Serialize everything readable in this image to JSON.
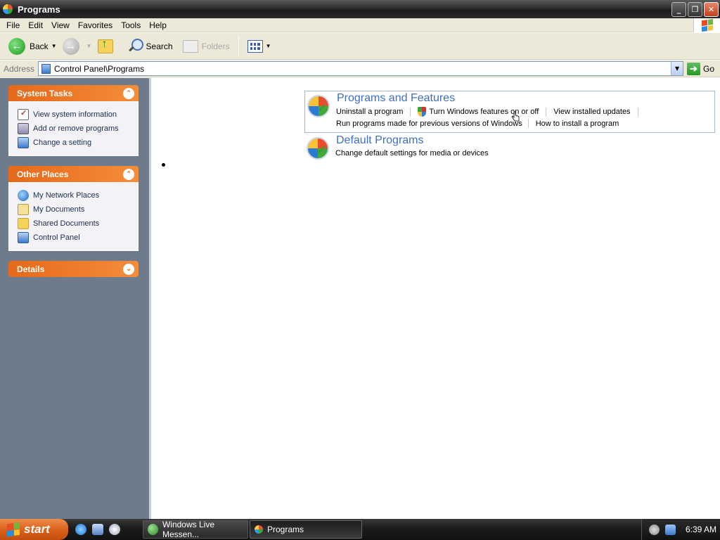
{
  "window": {
    "title": "Programs",
    "controls": [
      "minimize-icon",
      "restore-icon",
      "close-icon"
    ]
  },
  "menu": [
    "File",
    "Edit",
    "View",
    "Favorites",
    "Tools",
    "Help"
  ],
  "toolbar": {
    "back_label": "Back",
    "search_label": "Search",
    "folders_label": "Folders"
  },
  "address": {
    "label": "Address",
    "value": "Control Panel\\Programs",
    "go_label": "Go"
  },
  "sidebar": {
    "system_tasks": {
      "title": "System Tasks",
      "items": [
        {
          "label": "View system information",
          "icon": "system-info-icon"
        },
        {
          "label": "Add or remove programs",
          "icon": "add-remove-icon"
        },
        {
          "label": "Change a setting",
          "icon": "settings-icon"
        }
      ]
    },
    "other_places": {
      "title": "Other Places",
      "items": [
        {
          "label": "My Network Places",
          "icon": "network-icon"
        },
        {
          "label": "My Documents",
          "icon": "documents-icon"
        },
        {
          "label": "Shared Documents",
          "icon": "shared-folder-icon"
        },
        {
          "label": "Control Panel",
          "icon": "control-panel-icon"
        }
      ]
    },
    "details": {
      "title": "Details"
    }
  },
  "main": {
    "categories": [
      {
        "title": "Programs and Features",
        "links_row1": [
          "Uninstall a program",
          "Turn Windows features on or off",
          "View installed updates"
        ],
        "links_row2": [
          "Run programs made for previous versions of Windows",
          "How to install a program"
        ]
      },
      {
        "title": "Default Programs",
        "links_row1": [
          "Change default settings for media or devices"
        ]
      }
    ]
  },
  "taskbar": {
    "start_label": "start",
    "tasks": [
      "Windows Live Messen...",
      "Programs"
    ],
    "clock": "6:39 AM"
  },
  "colors": {
    "link_blue": "#3f6fc1",
    "panel_orange": "#e5691a",
    "sidebar_bg": "#6d7b8d"
  }
}
